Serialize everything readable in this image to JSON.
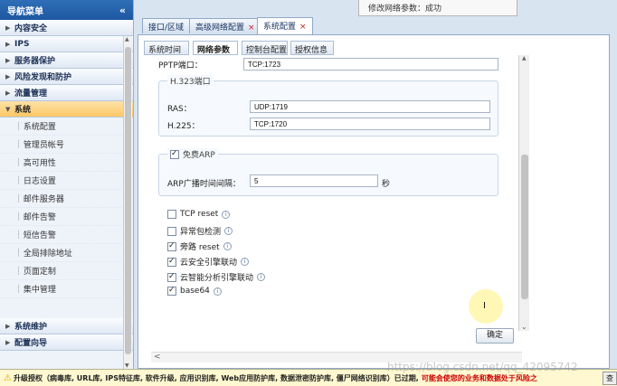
{
  "toast": {
    "text": "修改网络参数：成功"
  },
  "nav": {
    "title": "导航菜单",
    "collapse": "«",
    "groups_top": [
      "内容安全",
      "IPS",
      "服务器保护",
      "风险发现和防护",
      "流量管理"
    ],
    "active_group": "系统",
    "sub_items": [
      "系统配置",
      "管理员帐号",
      "高可用性",
      "日志设置",
      "邮件服务器",
      "邮件告警",
      "短信告警",
      "全局排除地址",
      "页面定制",
      "集中管理"
    ],
    "groups_bottom": [
      "系统维护",
      "配置向导"
    ]
  },
  "top_tabs": [
    {
      "label": "接口/区域"
    },
    {
      "label": "高级网络配置"
    },
    {
      "label": "系统配置"
    }
  ],
  "sub_tabs": [
    {
      "label": "系统时间"
    },
    {
      "label": "网络参数"
    },
    {
      "label": "控制台配置"
    },
    {
      "label": "授权信息"
    }
  ],
  "form": {
    "pptp_label": "PPTP端口：",
    "pptp_value": "TCP:1723",
    "h323_legend": "H.323端口",
    "ras_label": "RAS：",
    "ras_value": "UDP:1719",
    "h225_label": "H.225：",
    "h225_value": "TCP:1720",
    "arp_legend": "免费ARP",
    "arp_checked": true,
    "arp_interval_label": "ARP广播时间间隔：",
    "arp_interval_value": "5",
    "arp_unit": "秒",
    "checkboxes": [
      {
        "label": "TCP reset",
        "checked": false
      },
      {
        "label": "异常包检测",
        "checked": false
      },
      {
        "label": "旁路 reset",
        "checked": true
      },
      {
        "label": "云安全引擎联动",
        "checked": true
      },
      {
        "label": "云智能分析引擎联动",
        "checked": true
      },
      {
        "label": "base64",
        "checked": true
      }
    ],
    "ok_button": "确定"
  },
  "bottom_bar": {
    "text": "升级授权（病毒库, URL库, IPS特征库, 软件升级, 应用识别库, Web应用防护库, 数据泄密防护库, 僵尸网络识别库）已过期,",
    "red_text": "可能会使您的业务和数据处于风险之",
    "button": "查"
  },
  "watermark": "https://blog.csdn.net/qq_42095742"
}
